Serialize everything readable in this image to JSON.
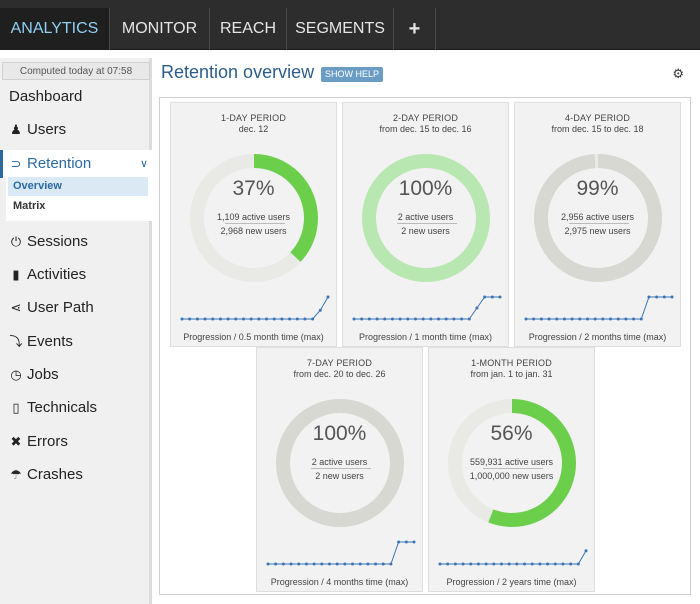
{
  "nav": {
    "tabs": [
      {
        "label": "ANALYTICS",
        "active": true
      },
      {
        "label": "MONITOR",
        "active": false
      },
      {
        "label": "REACH",
        "active": false
      },
      {
        "label": "SEGMENTS",
        "active": false
      },
      {
        "label": "+",
        "active": false
      }
    ]
  },
  "sidebar": {
    "computed": "Computed today at 07:58",
    "dashboard": "Dashboard",
    "users": "Users",
    "retention": "Retention",
    "sub": [
      "Overview",
      "Matrix"
    ],
    "items": [
      "Sessions",
      "Activities",
      "User Path",
      "Events",
      "Jobs",
      "Technicals",
      "Errors",
      "Crashes"
    ]
  },
  "main": {
    "title": "Retention overview",
    "help": "SHOW HELP"
  },
  "colors": {
    "accent": "#2b6aa3",
    "green": "#6ccf4c",
    "light_green": "#b9e7b1",
    "gray_ring": "#d8d8d2",
    "track": "#e9e9e6",
    "spark": "#3a74b6"
  },
  "cards": [
    {
      "title": "1-DAY PERIOD",
      "date": "dec. 12",
      "percent": "37%",
      "value": 0.37,
      "active": "1,109 active users",
      "new": "2,968 new users",
      "progression": "Progression / 0.5 month time (max)",
      "ring": "green",
      "spark": [
        0,
        0,
        0,
        0,
        0,
        0,
        0,
        0,
        0,
        0,
        0,
        0,
        0,
        0,
        0,
        0,
        0,
        0,
        0.4,
        1
      ]
    },
    {
      "title": "2-DAY PERIOD",
      "date": "from dec. 15 to dec. 16",
      "percent": "100%",
      "value": 1.0,
      "active": "2 active users",
      "new": "2 new users",
      "progression": "Progression / 1 month time (max)",
      "ring": "light_green",
      "spark": [
        0,
        0,
        0,
        0,
        0,
        0,
        0,
        0,
        0,
        0,
        0,
        0,
        0,
        0,
        0,
        0,
        0.5,
        1,
        1,
        1
      ]
    },
    {
      "title": "4-DAY PERIOD",
      "date": "from dec. 15 to dec. 18",
      "percent": "99%",
      "value": 0.99,
      "active": "2,956 active users",
      "new": "2,975 new users",
      "progression": "Progression / 2 months time (max)",
      "ring": "gray_ring",
      "spark": [
        0,
        0,
        0,
        0,
        0,
        0,
        0,
        0,
        0,
        0,
        0,
        0,
        0,
        0,
        0,
        0,
        1,
        1,
        1,
        1
      ]
    },
    {
      "title": "7-DAY PERIOD",
      "date": "from dec. 20 to dec. 26",
      "percent": "100%",
      "value": 1.0,
      "active": "2 active users",
      "new": "2 new users",
      "progression": "Progression / 4 months time (max)",
      "ring": "gray_ring",
      "spark": [
        0,
        0,
        0,
        0,
        0,
        0,
        0,
        0,
        0,
        0,
        0,
        0,
        0,
        0,
        0,
        0,
        0,
        1,
        1,
        1
      ]
    },
    {
      "title": "1-MONTH PERIOD",
      "date": "from jan. 1 to jan. 31",
      "percent": "56%",
      "value": 0.56,
      "active": "559,931 active users",
      "new": "1,000,000 new users",
      "progression": "Progression / 2 years time (max)",
      "ring": "green",
      "spark": [
        0,
        0,
        0,
        0,
        0,
        0,
        0,
        0,
        0,
        0,
        0,
        0,
        0,
        0,
        0,
        0,
        0,
        0,
        0,
        0.6
      ]
    }
  ]
}
